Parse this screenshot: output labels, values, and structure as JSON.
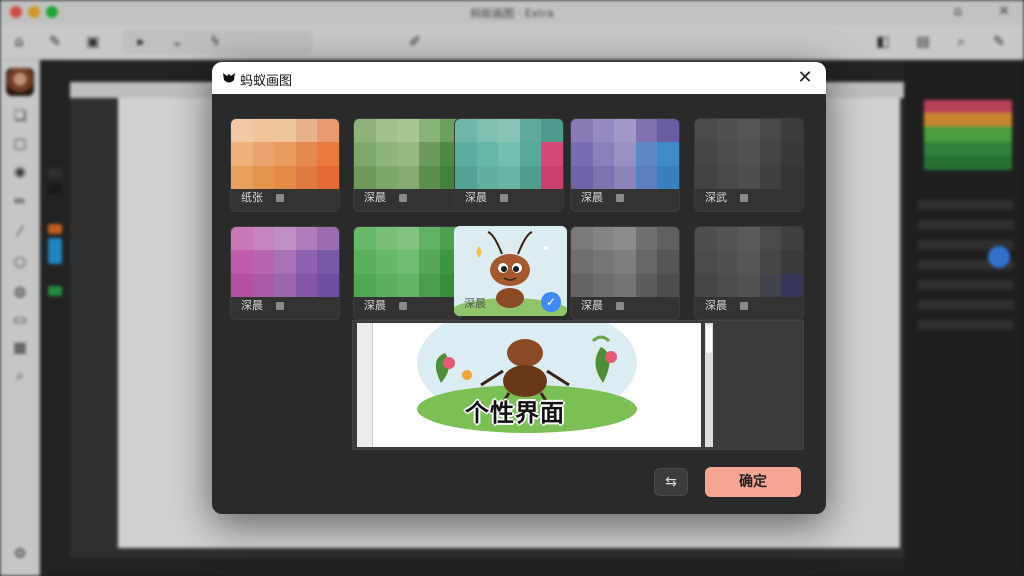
{
  "window": {
    "title": "蚂蚁画图 ‧ Extra"
  },
  "dialog": {
    "title": "蚂蚁画图",
    "close_icon": "close-icon",
    "logo_icon": "ant-logo-icon",
    "confirm_label": "确定",
    "swap_icon": "swap-icon",
    "preview_text": "个性界面",
    "themes_row1": [
      {
        "label": "纸张",
        "colors": [
          "#f2c9a4",
          "#f3c39a",
          "#efc59c",
          "#eab28a",
          "#e99a70",
          "#f0b07c",
          "#eba36e",
          "#e99a5e",
          "#e58a4e",
          "#ea7a3e",
          "#e8a05c",
          "#e5964e",
          "#e38c48",
          "#e07a40",
          "#e46a34"
        ]
      },
      {
        "label": "深晨",
        "colors": [
          "#8db37a",
          "#9fc28c",
          "#a7c892",
          "#88b376",
          "#6e9f5c",
          "#7fa86c",
          "#8fb57c",
          "#95b980",
          "#6c9a5a",
          "#4f8a44",
          "#6f9a5c",
          "#7ea76a",
          "#86ab70",
          "#5c8f4e",
          "#43803c"
        ]
      },
      {
        "label": "深晨",
        "colors": [
          "#6fb6a8",
          "#7ebfb0",
          "#86c4b6",
          "#5fa89a",
          "#4e9a8c",
          "#5caf9e",
          "#66b8a6",
          "#73bfae",
          "#58a897",
          "#d24a7a",
          "#52a393",
          "#5fb09f",
          "#68b5a4",
          "#4f9e8e",
          "#c8406e"
        ]
      },
      {
        "label": "深晨",
        "colors": [
          "#8a7ab8",
          "#968ac2",
          "#a198c9",
          "#7f70b0",
          "#6a5ea2",
          "#7a6cb0",
          "#8a80bc",
          "#9a90c4",
          "#5e88c8",
          "#3f8ac8",
          "#7062a6",
          "#7e72b0",
          "#8c84ba",
          "#5a7ec0",
          "#3a80c0"
        ]
      },
      {
        "label": "深武",
        "colors": [
          "#4a4a4a",
          "#505050",
          "#555555",
          "#484848",
          "#3c3c3c",
          "#464646",
          "#4c4c4c",
          "#525252",
          "#444444",
          "#383838",
          "#424242",
          "#484848",
          "#4e4e4e",
          "#404040",
          "#343434"
        ]
      }
    ],
    "themes_row2": [
      {
        "label": "深晨",
        "colors": [
          "#c878b4",
          "#c884bc",
          "#c090c4",
          "#b07cba",
          "#9c6cb2",
          "#c05cac",
          "#b866b2",
          "#aa72b6",
          "#8e62b0",
          "#7a58a8",
          "#b450a2",
          "#a85aa8",
          "#9a66ae",
          "#8456a6",
          "#6e4ea0"
        ]
      },
      {
        "label": "深晨",
        "colors": [
          "#6ab86a",
          "#78c078",
          "#80c480",
          "#62b062",
          "#4ea04e",
          "#5cb05c",
          "#66b866",
          "#70bc70",
          "#56a856",
          "#3e963e",
          "#52a852",
          "#5cb05c",
          "#66b466",
          "#4c9e4c",
          "#388e38"
        ]
      },
      {
        "label": "深晨",
        "colors": []
      },
      {
        "label": "深晨",
        "colors": [
          "#7a7a7a",
          "#848484",
          "#8c8c8c",
          "#707070",
          "#606060",
          "#6e6e6e",
          "#767676",
          "#7e7e7e",
          "#666666",
          "#565656",
          "#646464",
          "#6c6c6c",
          "#747474",
          "#5c5c5c",
          "#4e4e4e"
        ]
      },
      {
        "label": "深晨",
        "colors": [
          "#4e4e4e",
          "#545454",
          "#5a5a5a",
          "#4a4a4a",
          "#404040",
          "#4a4a4a",
          "#505050",
          "#565656",
          "#464646",
          "#3a3a3a",
          "#464646",
          "#4c4c4c",
          "#525252",
          "#42424e",
          "#363658"
        ]
      }
    ],
    "ant_card": {
      "label": "深晨",
      "check_icon": "check-badge-icon"
    }
  },
  "accent": {
    "confirm_bg": "#f5a592",
    "selected_badge": "#3d8af7"
  }
}
